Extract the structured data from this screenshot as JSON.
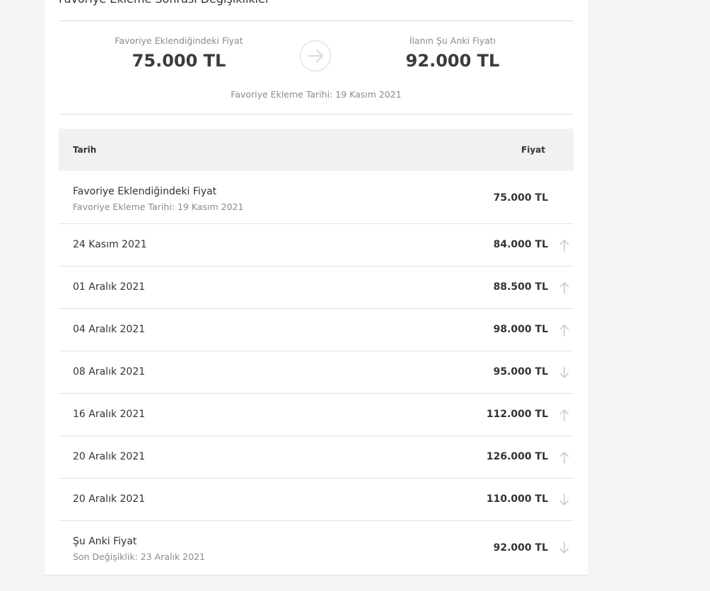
{
  "section": {
    "title": "Favoriye Ekleme Sonrası Değişiklikler"
  },
  "summary": {
    "added_label": "Favoriye Eklendiğindeki Fiyat",
    "added_value": "75.000 TL",
    "current_label": "İlanın Şu Anki Fiyatı",
    "current_value": "92.000 TL",
    "added_date": "Favoriye Ekleme Tarihi: 19 Kasım 2021",
    "arrow_icon": "arrow-right-icon"
  },
  "table": {
    "headers": {
      "date": "Tarih",
      "price": "Fiyat"
    },
    "rows": [
      {
        "date": "Favoriye Eklendiğindeki Fiyat",
        "sub": "Favoriye Ekleme Tarihi: 19 Kasım 2021",
        "price": "75.000 TL",
        "trend": "none"
      },
      {
        "date": "24 Kasım 2021",
        "sub": "",
        "price": "84.000 TL",
        "trend": "up"
      },
      {
        "date": "01 Aralık 2021",
        "sub": "",
        "price": "88.500 TL",
        "trend": "up"
      },
      {
        "date": "04 Aralık 2021",
        "sub": "",
        "price": "98.000 TL",
        "trend": "up"
      },
      {
        "date": "08 Aralık 2021",
        "sub": "",
        "price": "95.000 TL",
        "trend": "down"
      },
      {
        "date": "16 Aralık 2021",
        "sub": "",
        "price": "112.000 TL",
        "trend": "up"
      },
      {
        "date": "20 Aralık 2021",
        "sub": "",
        "price": "126.000 TL",
        "trend": "up"
      },
      {
        "date": "20 Aralık 2021",
        "sub": "",
        "price": "110.000 TL",
        "trend": "down"
      },
      {
        "date": "Şu Anki Fiyat",
        "sub": "Son Değişiklik: 23 Aralık 2021",
        "price": "92.000 TL",
        "trend": "down"
      }
    ]
  },
  "colors": {
    "page_background": "#f5f5f5",
    "card_background": "#ffffff",
    "header_background": "#f1f1f1",
    "muted_text": "#8a8a8a",
    "trend_icon": "#c8c8c8"
  }
}
